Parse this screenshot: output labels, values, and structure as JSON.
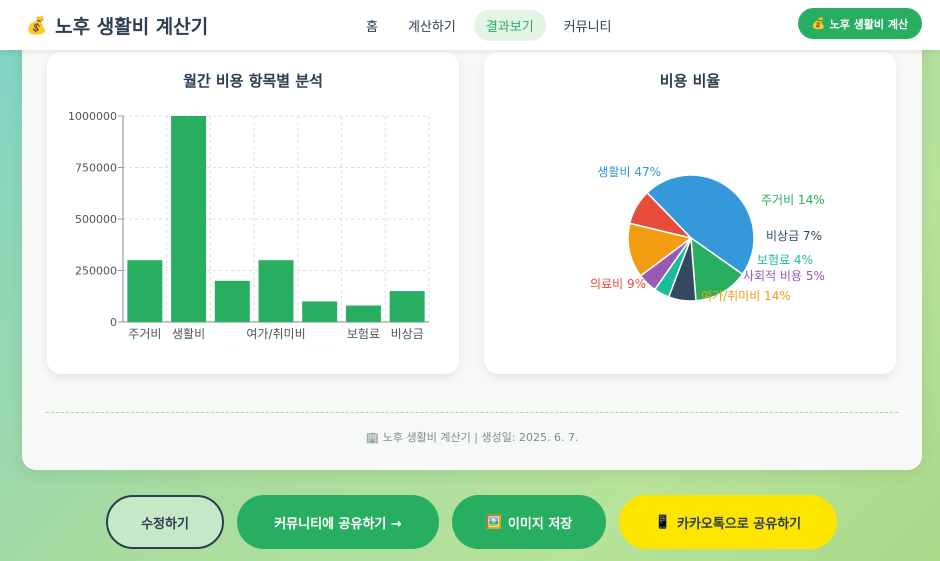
{
  "header": {
    "logo_icon": "money-bag-icon",
    "logo_emoji": "💰",
    "title": "노후 생활비 계산기",
    "nav": [
      {
        "label": "홈",
        "active": false
      },
      {
        "label": "계산하기",
        "active": false
      },
      {
        "label": "결과보기",
        "active": true
      },
      {
        "label": "커뮤니티",
        "active": false
      }
    ],
    "cta_emoji": "💰",
    "cta_label": "노후 생활비 계산"
  },
  "colors": {
    "green": "#27ae60",
    "blue": "#3498db",
    "navy": "#34495e",
    "teal": "#1abc9c",
    "purple": "#9b59b6",
    "orange": "#f39c12",
    "red": "#e74c3c",
    "text": "#2c3e50"
  },
  "chart_data": [
    {
      "type": "bar",
      "title": "월간 비용 항목별 분석",
      "categories": [
        "주거비",
        "생활비",
        "의료비",
        "여가/취미비",
        "사회적 비용",
        "보험료",
        "비상금"
      ],
      "visible_tick_labels": [
        "주거비",
        "생활비",
        "여가/취미비",
        "보험료",
        "비상금"
      ],
      "values": [
        300000,
        1000000,
        200000,
        300000,
        100000,
        80000,
        150000
      ],
      "yticks": [
        0,
        250000,
        500000,
        750000,
        1000000
      ],
      "ylim": [
        0,
        1000000
      ],
      "grid": true,
      "color": "#27ae60"
    },
    {
      "type": "pie",
      "title": "비용 비율",
      "slices": [
        {
          "label": "생활비",
          "value": 47,
          "text": "생활비 47%",
          "color": "#3498db"
        },
        {
          "label": "주거비",
          "value": 14,
          "text": "주거비 14%",
          "color": "#27ae60"
        },
        {
          "label": "비상금",
          "value": 7,
          "text": "비상금 7%",
          "color": "#34495e"
        },
        {
          "label": "보험료",
          "value": 4,
          "text": "보험료 4%",
          "color": "#1abc9c"
        },
        {
          "label": "사회적 비용",
          "value": 5,
          "text": "사회적 비용 5%",
          "color": "#9b59b6"
        },
        {
          "label": "여가/취미비",
          "value": 14,
          "text": "여가/취미비 14%",
          "color": "#f39c12"
        },
        {
          "label": "의료비",
          "value": 9,
          "text": "의료비 9%",
          "color": "#e74c3c"
        }
      ]
    }
  ],
  "footer": {
    "icon": "building-icon",
    "emoji": "🏢",
    "text": "노후 생활비 계산기 | 생성일: 2025. 6. 7."
  },
  "actions": {
    "edit_label": "수정하기",
    "share_label": "커뮤니티에 공유하기 →",
    "save_emoji": "🖼️",
    "save_label": "이미지 저장",
    "kakao_emoji": "📱",
    "kakao_label": "카카오톡으로 공유하기"
  }
}
